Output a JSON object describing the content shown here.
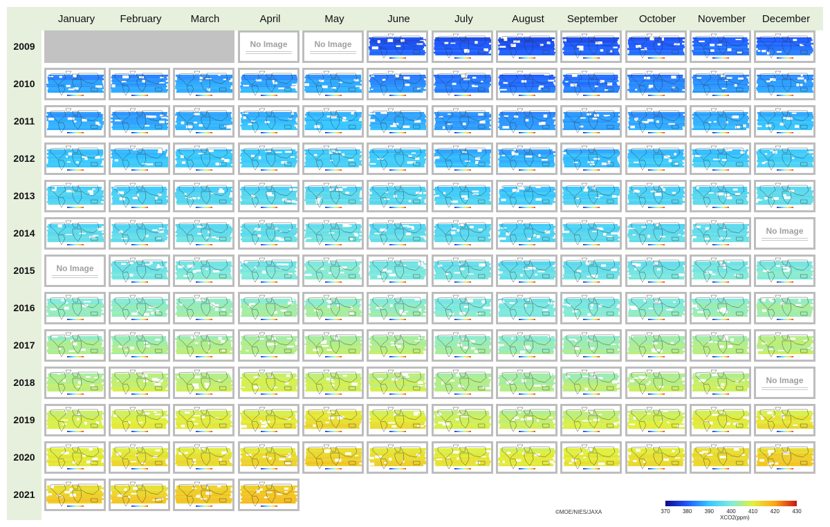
{
  "months": [
    "January",
    "February",
    "March",
    "April",
    "May",
    "June",
    "July",
    "August",
    "September",
    "October",
    "November",
    "December"
  ],
  "no_image_label": "No Image",
  "copyright": "©MOE/NIES/JAXA",
  "colorbar": {
    "title": "XCO2(ppm)",
    "min": 370,
    "max": 430,
    "ticks": [
      "370",
      "380",
      "390",
      "400",
      "410",
      "420",
      "430"
    ],
    "colors": [
      "#0a0a8c",
      "#1e5aff",
      "#37c8ff",
      "#82ebdc",
      "#e1f03c",
      "#ffa514",
      "#c81414"
    ]
  },
  "chart_data": {
    "type": "heatmap",
    "variable": "XCO2(ppm)",
    "x_categories": [
      "January",
      "February",
      "March",
      "April",
      "May",
      "June",
      "July",
      "August",
      "September",
      "October",
      "November",
      "December"
    ],
    "rows": [
      {
        "year": "2009",
        "status": [
          "na",
          "na",
          "na",
          "no_image",
          "no_image",
          "map",
          "map",
          "map",
          "map",
          "map",
          "map",
          "map"
        ],
        "xco2_ppm": [
          null,
          null,
          null,
          null,
          null,
          380,
          380,
          379,
          380,
          381,
          382,
          382
        ]
      },
      {
        "year": "2010",
        "status": [
          "map",
          "map",
          "map",
          "map",
          "map",
          "map",
          "map",
          "map",
          "map",
          "map",
          "map",
          "map"
        ],
        "xco2_ppm": [
          386,
          386,
          387,
          387,
          387,
          385,
          383,
          382,
          383,
          384,
          385,
          386
        ]
      },
      {
        "year": "2011",
        "status": [
          "map",
          "map",
          "map",
          "map",
          "map",
          "map",
          "map",
          "map",
          "map",
          "map",
          "map",
          "map"
        ],
        "xco2_ppm": [
          387,
          387,
          388,
          389,
          389,
          388,
          386,
          385,
          386,
          387,
          388,
          389
        ]
      },
      {
        "year": "2012",
        "status": [
          "map",
          "map",
          "map",
          "map",
          "map",
          "map",
          "map",
          "map",
          "map",
          "map",
          "map",
          "map"
        ],
        "xco2_ppm": [
          390,
          390,
          391,
          391,
          392,
          391,
          389,
          388,
          389,
          390,
          391,
          392
        ]
      },
      {
        "year": "2013",
        "status": [
          "map",
          "map",
          "map",
          "map",
          "map",
          "map",
          "map",
          "map",
          "map",
          "map",
          "map",
          "map"
        ],
        "xco2_ppm": [
          393,
          393,
          394,
          394,
          395,
          394,
          392,
          391,
          392,
          393,
          394,
          395
        ]
      },
      {
        "year": "2014",
        "status": [
          "map",
          "map",
          "map",
          "map",
          "map",
          "map",
          "map",
          "map",
          "map",
          "map",
          "map",
          "no_image"
        ],
        "xco2_ppm": [
          395,
          395,
          396,
          396,
          397,
          396,
          394,
          393,
          394,
          395,
          396,
          null
        ]
      },
      {
        "year": "2015",
        "status": [
          "no_image",
          "map",
          "map",
          "map",
          "map",
          "map",
          "map",
          "map",
          "map",
          "map",
          "map",
          "map"
        ],
        "xco2_ppm": [
          null,
          398,
          399,
          399,
          400,
          399,
          397,
          396,
          397,
          398,
          399,
          400
        ]
      },
      {
        "year": "2016",
        "status": [
          "map",
          "map",
          "map",
          "map",
          "map",
          "map",
          "map",
          "map",
          "map",
          "map",
          "map",
          "map"
        ],
        "xco2_ppm": [
          401,
          402,
          402,
          403,
          403,
          402,
          400,
          399,
          400,
          401,
          402,
          403
        ]
      },
      {
        "year": "2017",
        "status": [
          "map",
          "map",
          "map",
          "map",
          "map",
          "map",
          "map",
          "map",
          "map",
          "map",
          "map",
          "map"
        ],
        "xco2_ppm": [
          404,
          404,
          405,
          405,
          406,
          405,
          403,
          402,
          403,
          404,
          405,
          406
        ]
      },
      {
        "year": "2018",
        "status": [
          "map",
          "map",
          "map",
          "map",
          "map",
          "map",
          "map",
          "map",
          "map",
          "map",
          "map",
          "no_image"
        ],
        "xco2_ppm": [
          406,
          407,
          407,
          408,
          408,
          407,
          405,
          404,
          405,
          406,
          407,
          null
        ]
      },
      {
        "year": "2019",
        "status": [
          "map",
          "map",
          "map",
          "map",
          "map",
          "map",
          "map",
          "map",
          "map",
          "map",
          "map",
          "map"
        ],
        "xco2_ppm": [
          409,
          409,
          410,
          411,
          412,
          411,
          408,
          407,
          408,
          409,
          410,
          411
        ]
      },
      {
        "year": "2020",
        "status": [
          "map",
          "map",
          "map",
          "map",
          "map",
          "map",
          "map",
          "map",
          "map",
          "map",
          "map",
          "map"
        ],
        "xco2_ppm": [
          411,
          412,
          412,
          413,
          414,
          413,
          411,
          410,
          411,
          412,
          413,
          414
        ]
      },
      {
        "year": "2021",
        "status": [
          "map",
          "map",
          "map",
          "map"
        ],
        "xco2_ppm": [
          414,
          414,
          415,
          416
        ]
      }
    ]
  }
}
